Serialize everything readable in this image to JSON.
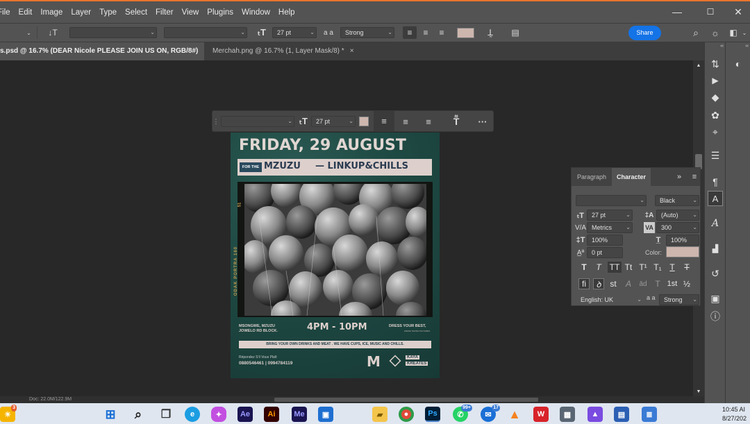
{
  "menu": [
    "File",
    "Edit",
    "Image",
    "Layer",
    "Type",
    "Select",
    "Filter",
    "View",
    "Plugins",
    "Window",
    "Help"
  ],
  "window_controls": {
    "minimize": "—",
    "restore": "☐",
    "close": "✕"
  },
  "options_bar": {
    "font_size": "27 pt",
    "aa_icon": "a a",
    "anti_alias": "Strong",
    "share_label": "Share",
    "text_color": "#cdb6ae"
  },
  "tabs": [
    {
      "label": "s.psd @ 16.7% (DEAR Nicole PLEASE JOIN US ON, RGB/8#) *",
      "close": "×"
    },
    {
      "label": "Merchah.png @ 16.7% (1, Layer Mask/8) *",
      "close": "×"
    }
  ],
  "floating_bar": {
    "font_size": "27 pt",
    "more": "···",
    "color": "#cdb6ae"
  },
  "poster": {
    "headline": "FRIDAY, 29 AUGUST",
    "for_the": "FOR THE",
    "mzuzu": "MZUZU",
    "linkup": "— LINKUP&CHILLS",
    "side_text": "ODAK PORTRA 160",
    "film_num": "51",
    "location_line1": "MSONGWE, MZUZU",
    "location_line2": "JOWELO RD BLOCK.",
    "time": "4PM - 10PM",
    "dress_line1": "DRESS YOUR BEST,",
    "dress_line2": "WE'RE TAKING PICTURES",
    "bring": "BRING YOUR OWN DRINKS AND MEAT . WE HAVE CUPS, ICE, MUSIC AND CHILLS.",
    "rsvp_label": "Répondez S'il Vous Plaît",
    "rsvp_numbers": "0880546461 | 0994784119",
    "logo_m": "M",
    "kaya_line1": "KAYA",
    "kaya_line2": "KREATES"
  },
  "character_panel": {
    "tab_paragraph": "Paragraph",
    "tab_character": "Character",
    "expand": "»",
    "font_style": "Black",
    "size": "27 pt",
    "leading": "(Auto)",
    "kerning": "Metrics",
    "tracking": "300",
    "vscale": "100%",
    "hscale": "100%",
    "baseline": "0 pt",
    "color_label": "Color:",
    "color": "#cdb6ae",
    "language": "English: UK",
    "aa_label": "a a",
    "anti_alias": "Strong",
    "style_buttons": [
      "T",
      "T",
      "TT",
      "Tt",
      "T¹",
      "T₁",
      "T",
      "T"
    ],
    "opentype_buttons": [
      "fi",
      "ꝺ",
      "st",
      "A",
      "ād",
      "T",
      "1st",
      "½"
    ]
  },
  "status_bar": {
    "doc": "Doc: 22.0M/122.9M"
  },
  "taskbar": {
    "weather_badge": "3",
    "ae": "Ae",
    "ai": "Ai",
    "me": "Me",
    "ps": "Ps",
    "whatsapp_badge": "99+",
    "messenger_badge": "17",
    "time": "10:45 AI",
    "date": "8/27/202"
  }
}
